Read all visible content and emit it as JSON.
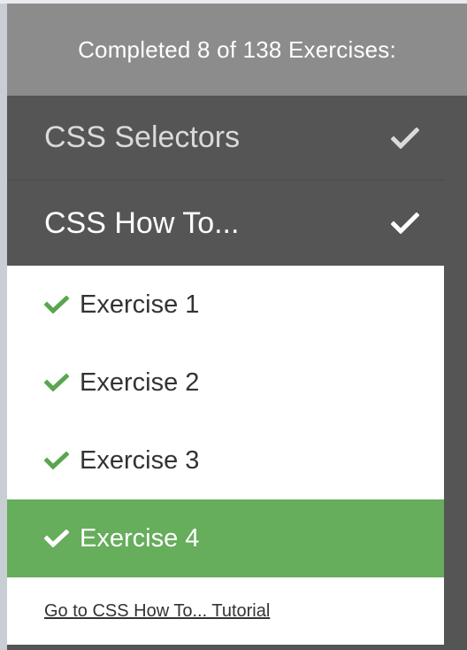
{
  "progress": {
    "title": "Completed 8 of 138 Exercises:",
    "completed": 8,
    "total": 138
  },
  "sections": [
    {
      "label": "CSS Selectors",
      "icon": "checkmark-icon"
    },
    {
      "label": "CSS How To...",
      "icon": "checkmark-icon"
    }
  ],
  "exercises": [
    {
      "label": "Exercise 1",
      "icon": "checkmark-icon"
    },
    {
      "label": "Exercise 2",
      "icon": "checkmark-icon"
    },
    {
      "label": "Exercise 3",
      "icon": "checkmark-icon"
    },
    {
      "label": "Exercise 4",
      "icon": "checkmark-icon"
    }
  ],
  "footer": {
    "link_label": "Go to CSS How To... Tutorial"
  },
  "colors": {
    "header_bg": "#8c8c8c",
    "panel_bg": "#555555",
    "check_green": "#5aa650",
    "active_bg": "#66ad5c"
  }
}
